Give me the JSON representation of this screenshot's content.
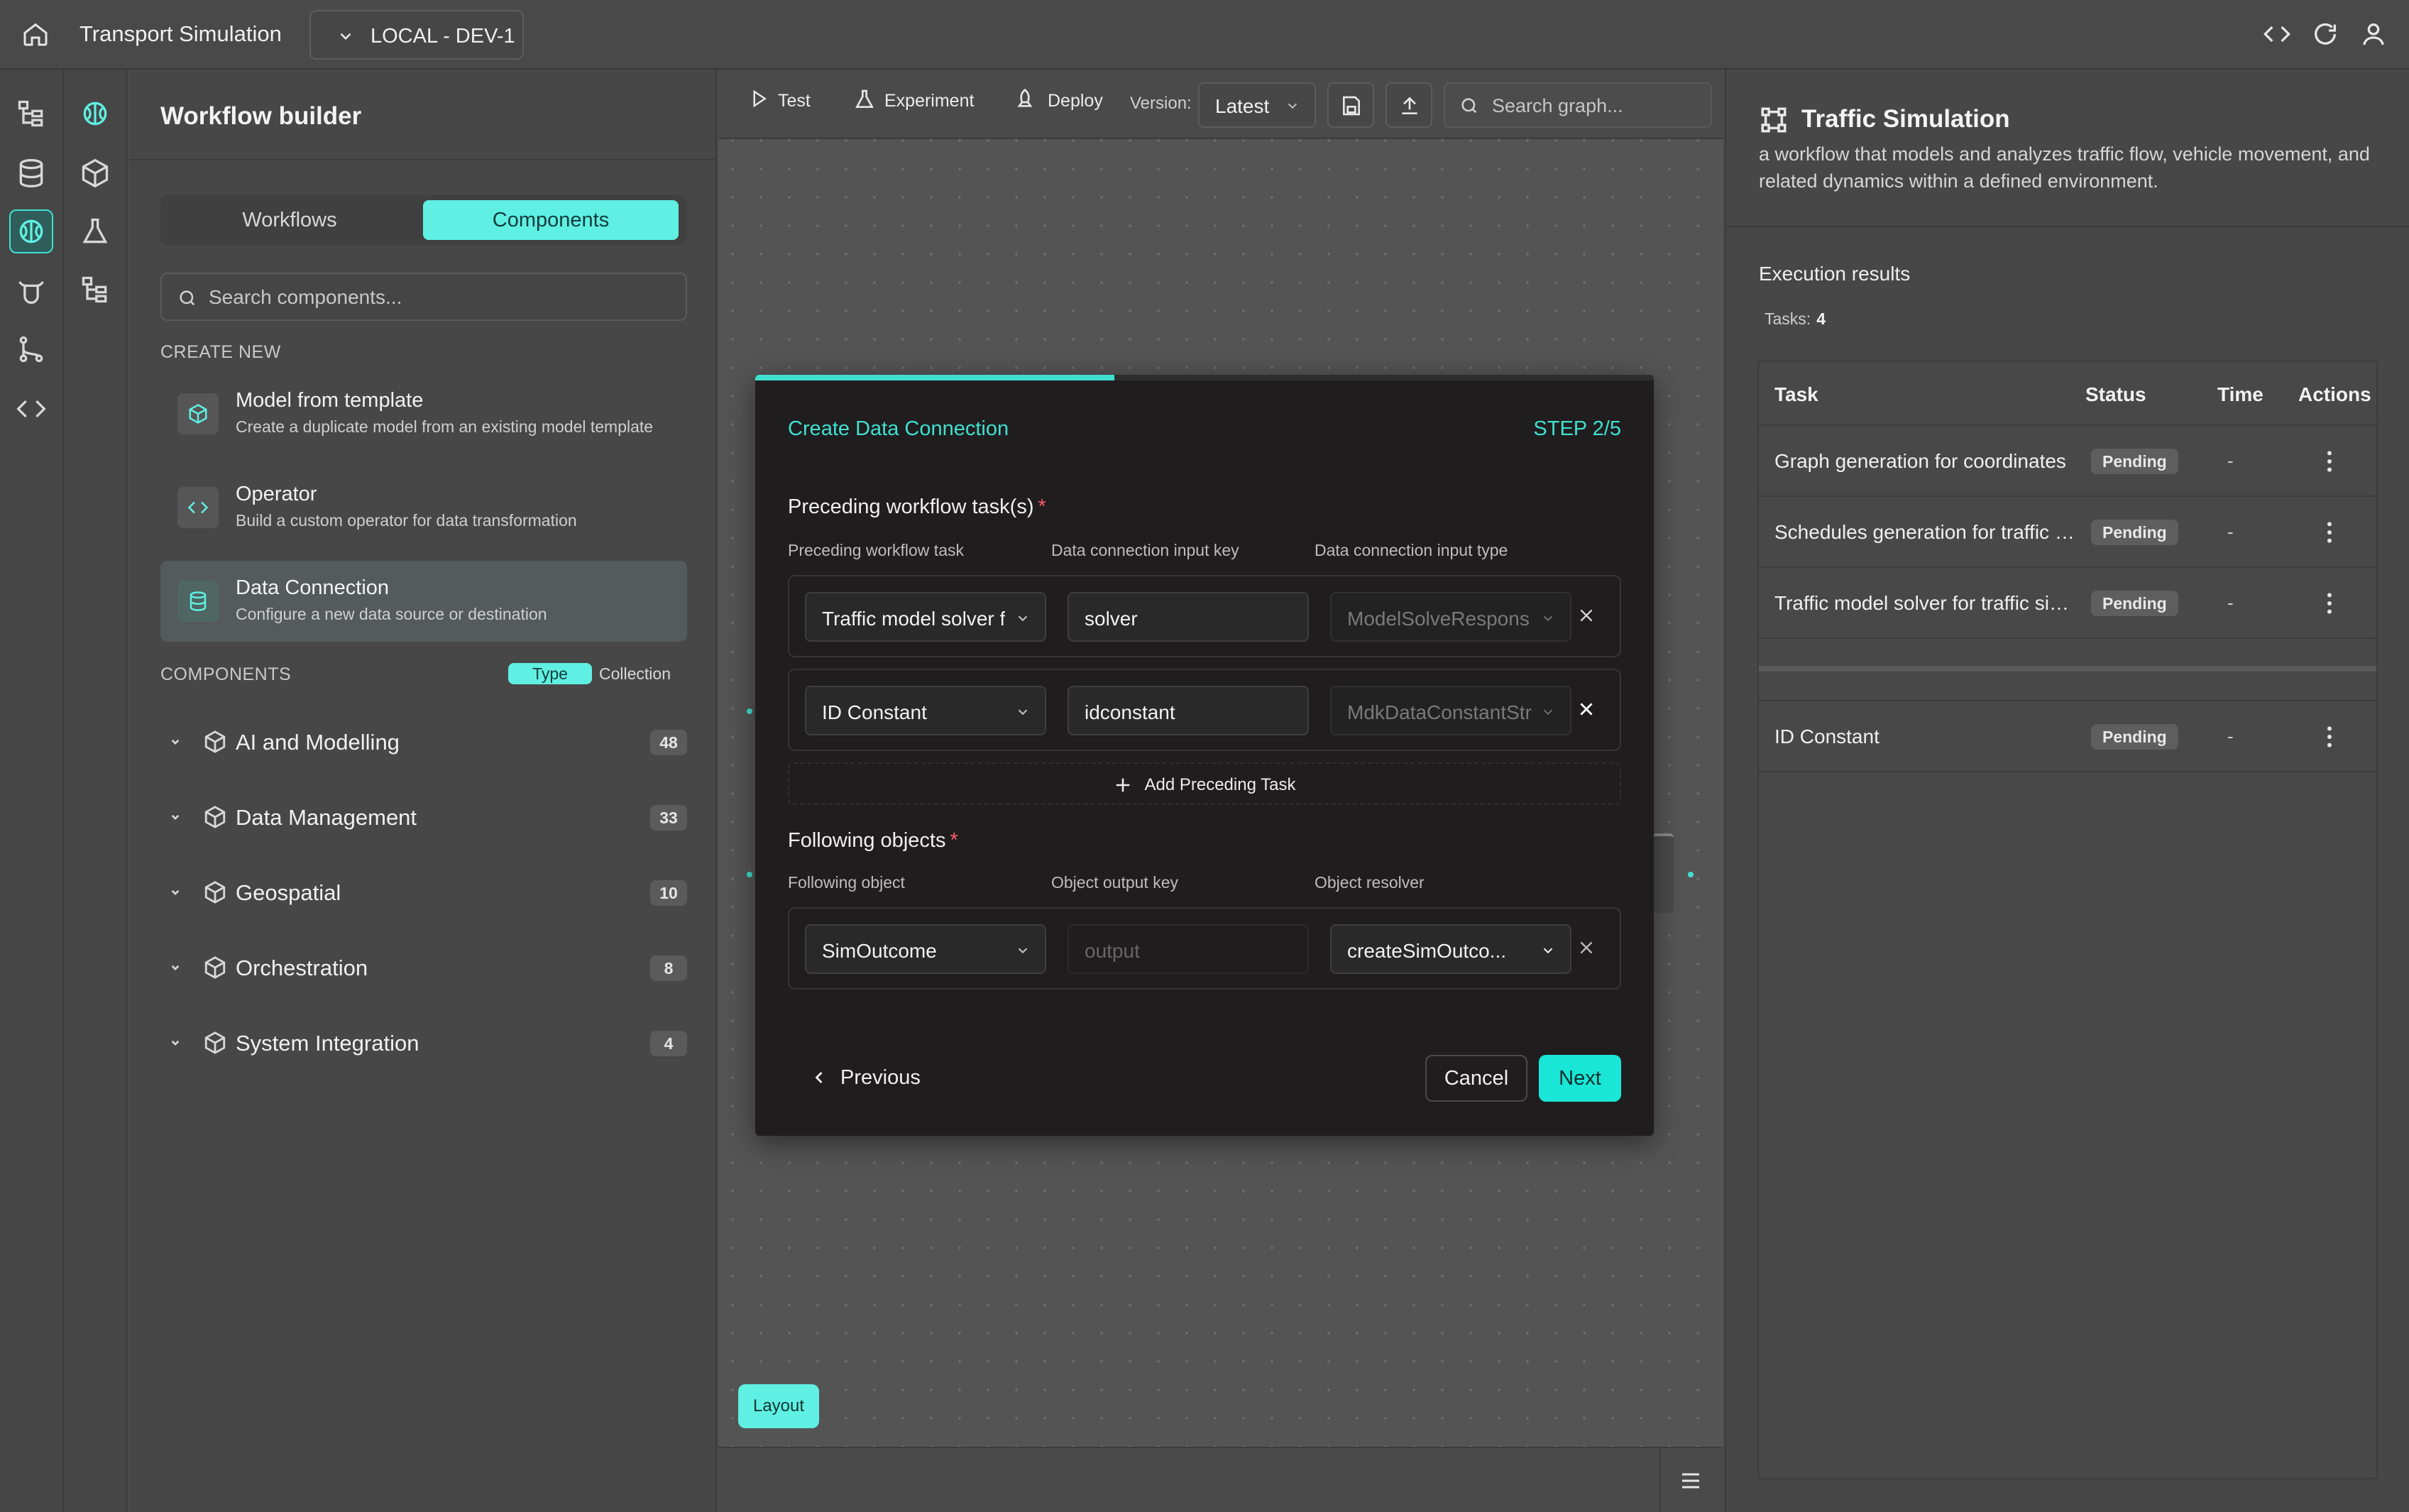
{
  "header": {
    "app_title": "Transport Simulation",
    "environment": "LOCAL - DEV-1"
  },
  "builder": {
    "title": "Workflow builder",
    "tabs": {
      "workflows": "Workflows",
      "components": "Components",
      "active": "Components"
    },
    "search_placeholder": "Search components...",
    "create_new_label": "CREATE NEW",
    "create_items": [
      {
        "title": "Model from template",
        "desc": "Create a duplicate model from an existing model template"
      },
      {
        "title": "Operator",
        "desc": "Build a custom operator for data transformation"
      },
      {
        "title": "Data Connection",
        "desc": "Configure a new data source or destination"
      }
    ],
    "components_label": "COMPONENTS",
    "group_toggle": {
      "type": "Type",
      "collection": "Collection",
      "active": "Type"
    },
    "categories": [
      {
        "label": "AI and Modelling",
        "count": "48"
      },
      {
        "label": "Data Management",
        "count": "33"
      },
      {
        "label": "Geospatial",
        "count": "10"
      },
      {
        "label": "Orchestration",
        "count": "8"
      },
      {
        "label": "System Integration",
        "count": "4"
      }
    ]
  },
  "canvas": {
    "toolbar": {
      "test": "Test",
      "experiment": "Experiment",
      "deploy": "Deploy",
      "version_label": "Version:",
      "version_value": "Latest",
      "search_placeholder": "Search graph..."
    },
    "layout_button": "Layout"
  },
  "modal": {
    "title": "Create Data Connection",
    "step": "STEP 2/5",
    "progress": 0.4,
    "preceding": {
      "section": "Preceding workflow task(s)",
      "col_task": "Preceding workflow task",
      "col_key": "Data connection input key",
      "col_type": "Data connection input type",
      "rows": [
        {
          "task": "Traffic model solver f",
          "key": "solver",
          "type": "ModelSolveRespons"
        },
        {
          "task": "ID Constant",
          "key": "idconstant",
          "type": "MdkDataConstantStr"
        }
      ],
      "add_label": "Add Preceding Task"
    },
    "following": {
      "section": "Following objects",
      "col_object": "Following object",
      "col_key": "Object output key",
      "col_resolver": "Object resolver",
      "rows": [
        {
          "object": "SimOutcome",
          "key_placeholder": "output",
          "resolver": "createSimOutco..."
        }
      ]
    },
    "buttons": {
      "previous": "Previous",
      "cancel": "Cancel",
      "next": "Next"
    }
  },
  "right_panel": {
    "title": "Traffic Simulation",
    "description": "a workflow that models and analyzes traffic flow, vehicle movement, and related dynamics within a defined environment.",
    "exec_title": "Execution results",
    "tasks_label": "Tasks:",
    "tasks_count": "4",
    "columns": {
      "task": "Task",
      "status": "Status",
      "time": "Time",
      "actions": "Actions"
    },
    "rows": [
      {
        "task": "Graph generation for coordinates",
        "status": "Pending",
        "time": "-"
      },
      {
        "task": "Schedules generation for traffic s...",
        "status": "Pending",
        "time": "-"
      },
      {
        "task": "Traffic model solver for traffic sim...",
        "status": "Pending",
        "time": "-"
      },
      {
        "task": "ID Constant",
        "status": "Pending",
        "time": "-"
      }
    ]
  },
  "colors": {
    "accent": "#40e0d0",
    "accent_button": "#19e6d6",
    "modal_bg": "#1f1d1e",
    "required": "#ff5a6a"
  }
}
